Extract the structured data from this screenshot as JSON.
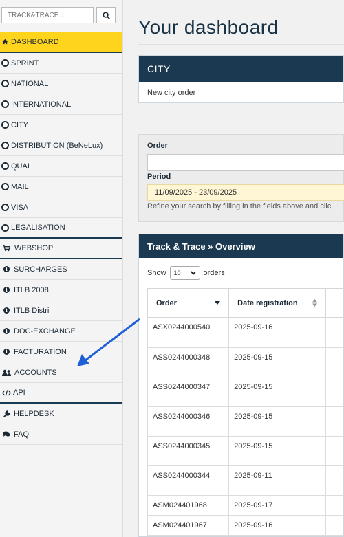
{
  "sidebar": {
    "search_placeholder": "TRACK&TRACE...",
    "items": [
      {
        "label": "DASHBOARD",
        "icon": "home-icon"
      },
      {
        "label": "SPRINT",
        "icon": "ring-icon"
      },
      {
        "label": "NATIONAL",
        "icon": "ring-icon"
      },
      {
        "label": "INTERNATIONAL",
        "icon": "ring-icon"
      },
      {
        "label": "CITY",
        "icon": "ring-icon"
      },
      {
        "label": "DISTRIBUTION (BeNeLux)",
        "icon": "ring-icon"
      },
      {
        "label": "QUAI",
        "icon": "ring-icon"
      },
      {
        "label": "MAIL",
        "icon": "ring-icon"
      },
      {
        "label": "VISA",
        "icon": "ring-icon"
      },
      {
        "label": "LEGALISATION",
        "icon": "ring-icon"
      },
      {
        "label": "WEBSHOP",
        "icon": "cart-icon"
      },
      {
        "label": "SURCHARGES",
        "icon": "info-icon"
      },
      {
        "label": "ITLB 2008",
        "icon": "info-icon"
      },
      {
        "label": "ITLB Distri",
        "icon": "info-icon"
      },
      {
        "label": "DOC-EXCHANGE",
        "icon": "info-icon"
      },
      {
        "label": "FACTURATION",
        "icon": "info-icon"
      },
      {
        "label": "ACCOUNTS",
        "icon": "users-icon"
      },
      {
        "label": "API",
        "icon": "code-icon"
      },
      {
        "label": "HELPDESK",
        "icon": "wrench-icon"
      },
      {
        "label": "FAQ",
        "icon": "comments-icon"
      }
    ]
  },
  "main": {
    "title": "Your dashboard",
    "city": {
      "header": "CITY",
      "link": "New city order"
    },
    "filter": {
      "order_label": "Order",
      "period_label": "Period",
      "period_value": "11/09/2025 - 23/09/2025",
      "hint": "Refine your search by filling in the fields above and clic"
    },
    "track": {
      "header": "Track & Trace » Overview",
      "show_label": "Show",
      "show_value": "10",
      "orders_label": "orders",
      "columns": [
        "Order",
        "Date registration"
      ],
      "rows": [
        {
          "order": "ASX0244000540",
          "date": "2025-09-16"
        },
        {
          "order": "ASS0244000348",
          "date": "2025-09-15"
        },
        {
          "order": "ASS0244000347",
          "date": "2025-09-15"
        },
        {
          "order": "ASS0244000346",
          "date": "2025-09-15"
        },
        {
          "order": "ASS0244000345",
          "date": "2025-09-15"
        },
        {
          "order": "ASS0244000344",
          "date": "2025-09-11"
        },
        {
          "order": "ASM024401968",
          "date": "2025-09-17"
        },
        {
          "order": "ASM024401967",
          "date": "2025-09-16"
        }
      ]
    }
  },
  "colors": {
    "accent": "#ffd41c",
    "navy": "#1b3a52",
    "arrow": "#1f5fd6"
  }
}
